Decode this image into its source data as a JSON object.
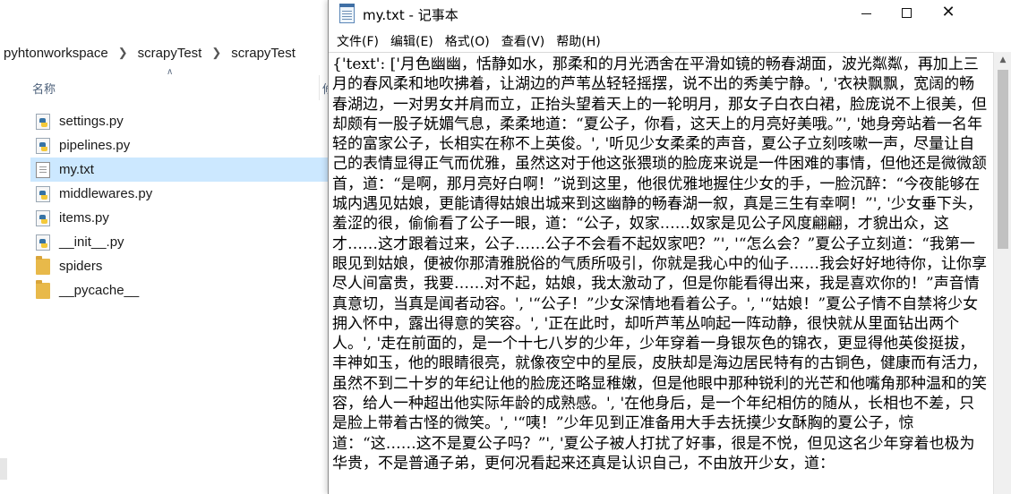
{
  "explorer": {
    "breadcrumb": [
      "pyhtonworkspace",
      "scrapyTest",
      "scrapyTest"
    ],
    "column_name": "名称",
    "column_next": "修",
    "files": [
      {
        "name": "settings.py",
        "type": "py"
      },
      {
        "name": "pipelines.py",
        "type": "py"
      },
      {
        "name": "my.txt",
        "type": "txt",
        "selected": true
      },
      {
        "name": "middlewares.py",
        "type": "py"
      },
      {
        "name": "items.py",
        "type": "py"
      },
      {
        "name": "__init__.py",
        "type": "py"
      },
      {
        "name": "spiders",
        "type": "folder"
      },
      {
        "name": "__pycache__",
        "type": "folder"
      }
    ]
  },
  "notepad": {
    "title": "my.txt - 记事本",
    "menu": [
      "文件(F)",
      "编辑(E)",
      "格式(O)",
      "查看(V)",
      "帮助(H)"
    ],
    "content": "{'text': ['月色幽幽，恬静如水，那柔和的月光洒舍在平滑如镜的畅春湖面，波光粼粼，再加上三月的春风柔和地吹拂着，让湖边的芦苇丛轻轻摇摆，说不出的秀美宁静。', '衣袂飘飘，宽阔的畅春湖边，一对男女并肩而立，正抬头望着天上的一轮明月，那女子白衣白裙，脸庞说不上很美，但却颇有一股子妩媚气息，柔柔地道：“夏公子，你看，这天上的月亮好美哦。”', '她身旁站着一名年轻的富家公子，长相实在称不上英俊。', '听见少女柔柔的声音，夏公子立刻咳嗽一声，尽量让自己的表情显得正气而优雅，虽然这对于他这张猥琐的脸庞来说是一件困难的事情，但他还是微微颔首，道：“是啊，那月亮好白啊！”说到这里，他很优雅地握住少女的手，一脸沉醉：“今夜能够在城内遇见姑娘，更能请得姑娘出城来到这幽静的畅春湖一叙，真是三生有幸啊！”', '少女垂下头，羞涩的很，偷偷看了公子一眼，道：“公子，奴家……奴家是见公子风度翩翩，才貌出众，这才……这才跟着过来，公子……公子不会看不起奴家吧？”', '“怎么会？”夏公子立刻道：“我第一眼见到姑娘，便被你那清雅脱俗的气质所吸引，你就是我心中的仙子……我会好好地待你，让你享尽人间富贵，我要……对不起，姑娘，我太激动了，但是你能看得出来，我是喜欢你的！”声音情真意切，当真是闻者动容。', '“公子！”少女深情地看着公子。', '“姑娘！”夏公子情不自禁将少女拥入怀中，露出得意的笑容。', '正在此时，却听芦苇丛响起一阵动静，很快就从里面钻出两个人。', '走在前面的，是一个十七八岁的少年，少年穿着一身银灰色的锦衣，更显得他英俊挺拔，丰神如玉，他的眼睛很亮，就像夜空中的星辰，皮肤却是海边居民特有的古铜色，健康而有活力，虽然不到二十岁的年纪让他的脸庞还略显稚嫩，但是他眼中那种锐利的光芒和他嘴角那种温和的笑容，给人一种超出他实际年龄的成熟感。', '在他身后，是一个年纪相仿的随从，长相也不差，只是脸上带着古怪的微笑。', '“咦！”少年见到正准备用大手去抚摸少女酥胸的夏公子，惊道：“这……这不是夏公子吗？”', '夏公子被人打扰了好事，很是不悦，但见这名少年穿着也极为华贵，不是普通子弟，更何况看起来还真是认识自己，不由放开少女，道："
  }
}
